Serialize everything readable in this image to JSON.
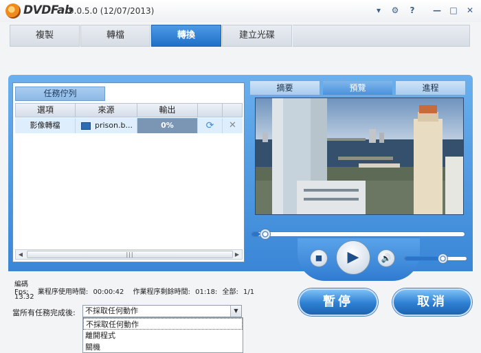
{
  "app": {
    "logo_text": "DVDFab",
    "version": "9.0.5.0 (12/07/2013)"
  },
  "titlebar_icons": [
    "menu-icon",
    "gear-icon",
    "help-icon",
    "minimize-icon",
    "maximize-icon",
    "close-icon"
  ],
  "titlebar_glyphs": {
    "menu": "▾",
    "settings": "⚙",
    "help": "?",
    "minimize": "—",
    "maximize": "□",
    "close": "✕"
  },
  "tabs": [
    {
      "label": "複製",
      "active": false
    },
    {
      "label": "轉檔",
      "active": false
    },
    {
      "label": "轉換",
      "active": true
    },
    {
      "label": "建立光碟",
      "active": false
    }
  ],
  "queue": {
    "title": "任務佇列",
    "columns": [
      "選項",
      "來源",
      "輸出"
    ],
    "rows": [
      {
        "option": "影像轉檔",
        "source": "prison.b...",
        "progress_text": "0%",
        "progress": 0
      }
    ],
    "scroll_grip": "|||"
  },
  "preview": {
    "tabs": [
      {
        "label": "摘要",
        "active": false
      },
      {
        "label": "預覽",
        "active": true
      },
      {
        "label": "進程",
        "active": false
      }
    ],
    "seek_position": 0.04,
    "volume": 0.6
  },
  "controls": {
    "stop_glyph": "■",
    "play_glyph": "▶",
    "volume_glyph": "🔊"
  },
  "status": {
    "encoding_label": "編碼",
    "fps_label": "Fps:",
    "elapsed_label": "業程序使用時間:",
    "elapsed_value": "00:00:42",
    "remaining_label": "作業程序剩餘時間:",
    "remaining_value": "01:18:",
    "total_label": "全部:",
    "total_value": "1/1",
    "fps_value": "13.32"
  },
  "buttons": {
    "pause": "暫停",
    "cancel": "取消"
  },
  "after_complete": {
    "label": "當所有任務完成後:",
    "selected": "不採取任何動作",
    "options": [
      "不採取任何動作",
      "離開程式",
      "關機"
    ]
  },
  "colors": {
    "accent": "#2a74c9",
    "tab_active": "#1f6fc7",
    "panel": "#3a86d6"
  }
}
